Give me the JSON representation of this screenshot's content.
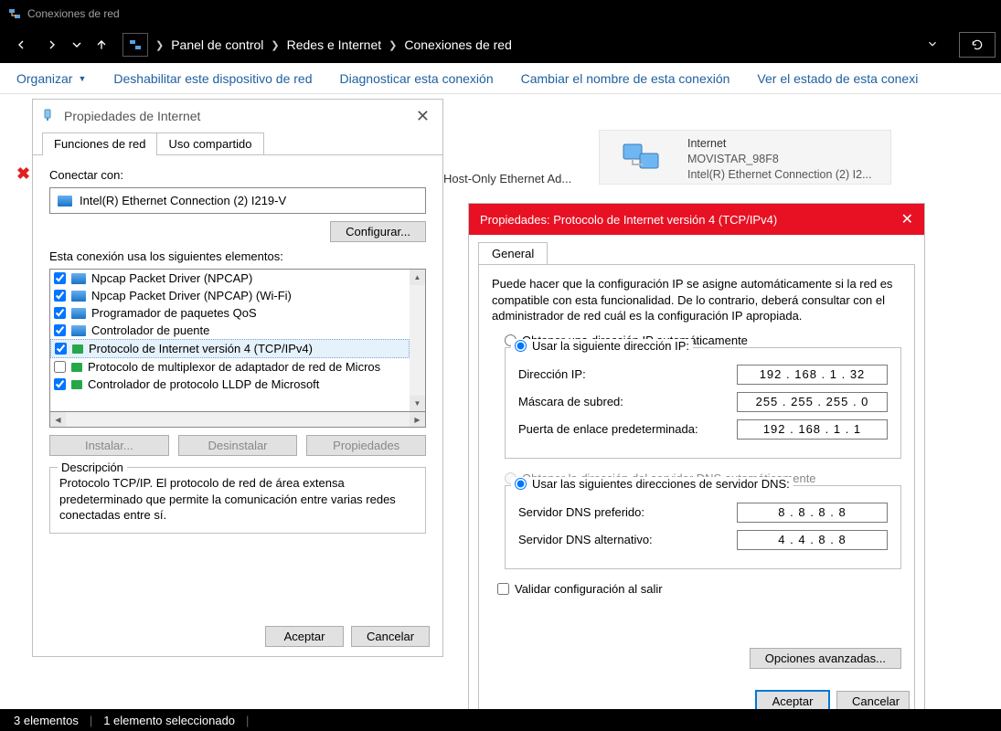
{
  "window": {
    "title": "Conexiones de red"
  },
  "breadcrumb": {
    "i1": "Panel de control",
    "i2": "Redes e Internet",
    "i3": "Conexiones de red"
  },
  "cmdbar": {
    "organize": "Organizar",
    "disable": "Deshabilitar este dispositivo de red",
    "diagnose": "Diagnosticar esta conexión",
    "rename": "Cambiar el nombre de esta conexión",
    "viewstatus": "Ver el estado de esta conexi"
  },
  "status": {
    "count": "3 elementos",
    "selected": "1 elemento seleccionado"
  },
  "netitem": {
    "name": "Internet",
    "ssid": "MOVISTAR_98F8",
    "adapter": "Intel(R) Ethernet Connection (2) I2..."
  },
  "peek": {
    "hostonly": "Host-Only Ethernet Ad..."
  },
  "dlg1": {
    "title": "Propiedades de Internet",
    "tab1": "Funciones de red",
    "tab2": "Uso compartido",
    "connect_with": "Conectar con:",
    "adapter": "Intel(R) Ethernet Connection (2) I219-V",
    "configure_btn": "Configurar...",
    "uses_label": "Esta conexión usa los siguientes elementos:",
    "items": [
      "Npcap Packet Driver (NPCAP)",
      "Npcap Packet Driver (NPCAP) (Wi-Fi)",
      "Programador de paquetes QoS",
      "Controlador de puente",
      "Protocolo de Internet versión 4 (TCP/IPv4)",
      "Protocolo de multiplexor de adaptador de red de Micros",
      "Controlador de protocolo LLDP de Microsoft"
    ],
    "install": "Instalar...",
    "uninstall": "Desinstalar",
    "properties": "Propiedades",
    "desc_legend": "Descripción",
    "desc_text": "Protocolo TCP/IP. El protocolo de red de área extensa predeterminado que permite la comunicación entre varias redes conectadas entre sí.",
    "ok": "Aceptar",
    "cancel": "Cancelar"
  },
  "dlg2": {
    "title": "Propiedades: Protocolo de Internet versión 4 (TCP/IPv4)",
    "tab": "General",
    "help": "Puede hacer que la configuración IP se asigne automáticamente si la red es compatible con esta funcionalidad. De lo contrario, deberá consultar con el administrador de red cuál es la configuración IP apropiada.",
    "r_ip_auto": "Obtener una dirección IP automáticamente",
    "r_ip_manual": "Usar la siguiente dirección IP:",
    "ip_label": "Dirección IP:",
    "ip_value": "192 . 168 .  1  . 32",
    "mask_label": "Máscara de subred:",
    "mask_value": "255 . 255 . 255 .  0",
    "gw_label": "Puerta de enlace predeterminada:",
    "gw_value": "192 . 168 .  1  .  1",
    "r_dns_auto": "Obtener la dirección del servidor DNS automáticamente",
    "r_dns_manual": "Usar las siguientes direcciones de servidor DNS:",
    "dns1_label": "Servidor DNS preferido:",
    "dns1_value": "8  .  8  .  8  .  8",
    "dns2_label": "Servidor DNS alternativo:",
    "dns2_value": "4  .  4  .  8  .  8",
    "validate": "Validar configuración al salir",
    "advanced": "Opciones avanzadas...",
    "ok": "Aceptar",
    "cancel": "Cancelar"
  }
}
